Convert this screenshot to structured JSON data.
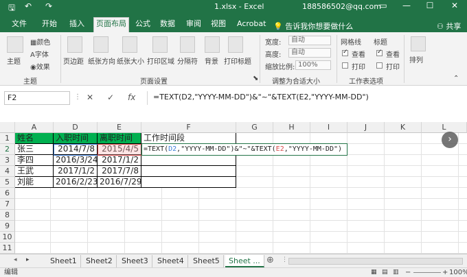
{
  "titlebar": {
    "save_icon": "save-icon",
    "undo_icon": "undo-icon",
    "redo_icon": "redo-icon",
    "title": "1.xlsx - Excel",
    "account": "188586502@qq.com",
    "ribbon_display_icon": "ribbon-display-icon",
    "min": "—",
    "max": "☐",
    "close": "✕"
  },
  "tabs": [
    {
      "label": "文件"
    },
    {
      "label": "开始"
    },
    {
      "label": "插入"
    },
    {
      "label": "页面布局"
    },
    {
      "label": "公式"
    },
    {
      "label": "数据"
    },
    {
      "label": "审阅"
    },
    {
      "label": "视图"
    },
    {
      "label": "Acrobat"
    }
  ],
  "tellme": "告诉我你想要做什么",
  "share": "共享",
  "ribbon": {
    "theme": {
      "main": "主题",
      "colors": "颜色",
      "fonts": "字体",
      "effects": "效果",
      "group": "主题"
    },
    "page_setup": {
      "margins": "页边距",
      "orientation": "纸张方向",
      "size": "纸张大小",
      "print_area": "打印区域",
      "breaks": "分隔符",
      "background": "背景",
      "print_titles": "打印标题",
      "group": "页面设置"
    },
    "scale": {
      "width_label": "宽度:",
      "width_value": "自动",
      "height_label": "高度:",
      "height_value": "自动",
      "scale_label": "缩放比例:",
      "scale_value": "100%",
      "group": "调整为合适大小"
    },
    "sheet_options": {
      "gridlines": "网格线",
      "headings": "标题",
      "view1": "查看",
      "view2": "查看",
      "print1": "打印",
      "print2": "打印",
      "group": "工作表选项"
    },
    "arrange": {
      "label": "排列"
    }
  },
  "formula_bar": {
    "name_box": "F2",
    "cancel": "✕",
    "enter": "✓",
    "fx": "fx",
    "formula": "=TEXT(D2,\"YYYY-MM-DD\")&\"~\"&TEXT(E2,\"YYYY-MM-DD\")"
  },
  "columns": [
    "A",
    "D",
    "E",
    "F",
    "G",
    "H",
    "I",
    "J",
    "K",
    "L"
  ],
  "rows": [
    "1",
    "2",
    "3",
    "4",
    "5",
    "6",
    "7",
    "8",
    "9",
    "10",
    "11"
  ],
  "table": {
    "headers": [
      "姓名",
      "入职时间",
      "离职时间",
      "工作时间段"
    ],
    "rows": [
      [
        "张三",
        "2014/7/8",
        "2015/4/5"
      ],
      [
        "李四",
        "2016/3/24",
        "2017/1/2"
      ],
      [
        "王武",
        "2017/1/2",
        "2017/7/8"
      ],
      [
        "刘能",
        "2016/2/23",
        "2016/7/29"
      ]
    ],
    "editing": {
      "prefix": "=TEXT(",
      "ref1": "D2",
      "mid": ",\"YYYY-MM-DD\")&\"~\"&TEXT(",
      "ref2": "E2",
      "suffix": ",\"YYYY-MM-DD\")"
    }
  },
  "sheets": [
    "Sheet1",
    "Sheet2",
    "Sheet3",
    "Sheet4",
    "Sheet5",
    "Sheet ..."
  ],
  "status": {
    "mode": "编辑",
    "zoom": "100%"
  }
}
